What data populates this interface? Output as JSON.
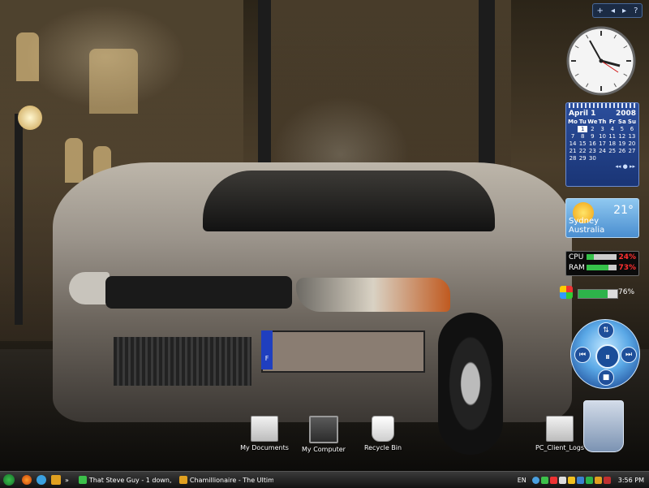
{
  "gadget_toolbar": {
    "add": "+",
    "prev": "◂",
    "next": "▸",
    "help": "?"
  },
  "calendar": {
    "month": "April 1",
    "year": "2008",
    "day_names": [
      "Mo",
      "Tu",
      "We",
      "Th",
      "Fr",
      "Sa",
      "Su"
    ],
    "weeks": [
      [
        "",
        "",
        "1",
        "2",
        "3",
        "4",
        "5",
        "6"
      ],
      [
        "7",
        "8",
        "9",
        "10",
        "11",
        "12",
        "13"
      ],
      [
        "14",
        "15",
        "16",
        "17",
        "18",
        "19",
        "20"
      ],
      [
        "21",
        "22",
        "23",
        "24",
        "25",
        "26",
        "27"
      ],
      [
        "28",
        "29",
        "30",
        "",
        "",
        "",
        ""
      ]
    ],
    "today": "1",
    "nav": "◂◂ ● ▸▸"
  },
  "weather": {
    "temp": "21°",
    "city": "Sydney",
    "country": "Australia"
  },
  "meter": {
    "cpu_label": "CPU",
    "cpu_value": "24%",
    "cpu_level": 0.24,
    "ram_label": "RAM",
    "ram_value": "73%",
    "ram_level": 0.73
  },
  "battery": {
    "value": "76%",
    "level": 0.76
  },
  "media_player": {
    "play_icon": "⏸",
    "up": "⇅",
    "prev": "⏮",
    "next": "⏭",
    "stop": "■"
  },
  "desktop_icons": {
    "my_documents": "My Documents",
    "my_computer": "My Computer",
    "recycle_bin": "Recycle Bin",
    "pc_client_logs": "PC_Client_Logs"
  },
  "taskbar": {
    "tasks": [
      {
        "label": "That Steve Guy - 1 down,..."
      },
      {
        "label": "Chamillionaire - The Ultim..."
      }
    ],
    "chevron": "»",
    "language": "EN",
    "time": "3:56 PM"
  },
  "colors": {
    "taskbar": "#121212",
    "calendar_bg": "#2b4e9c",
    "weather_bg": "#4a8ed0",
    "meter_fill": "#36c24a",
    "meter_value": "#ff3030"
  }
}
